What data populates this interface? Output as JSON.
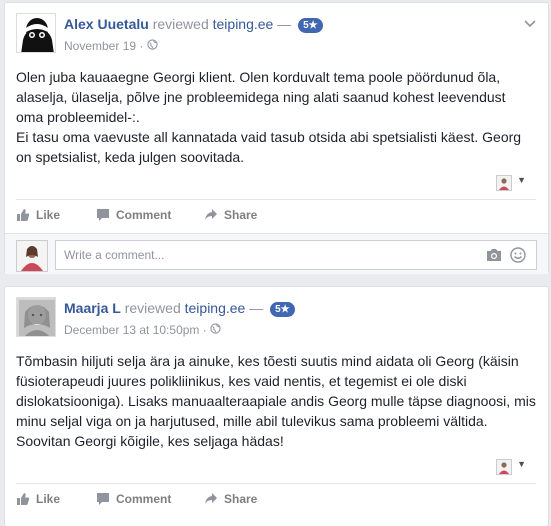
{
  "reviews": [
    {
      "author": "Alex Uuetalu",
      "action": "reviewed",
      "page": "teiping.ee",
      "separator": "—",
      "rating": "5★",
      "date": "November 19",
      "dot": "·",
      "text": [
        "Olen juba kauaaegne Georgi klient. Olen korduvalt tema poole pöördunud õla, alaselja, ülaselja, põlve jne probleemidega ning alati saanud kohest leevendust oma probleemidel-:.",
        "Ei tasu oma vaevuste all kannatada vaid tasub otsida abi spetsialisti käest. Georg on spetsialist, keda julgen soovitada."
      ]
    },
    {
      "author": "Maarja L",
      "action": "reviewed",
      "page": "teiping.ee",
      "separator": "—",
      "rating": "5★",
      "date": "December 13 at 10:50pm",
      "dot": "·",
      "text": [
        "Tõmbasin hiljuti selja ära ja ainuke, kes tõesti suutis mind aidata oli Georg (käisin füsioterapeudi juures polikliinikus, kes vaid nentis, et tegemist ei ole diski dislokatsiooniga). Lisaks manuaalteraapiale andis Georg mulle täpse diagnoosi, mis minu seljal viga on ja harjutused, mille abil tulevikus sama probleemi vältida. Soovitan Georgi kõigile, kes seljaga hädas!"
      ]
    }
  ],
  "actions": {
    "like": "Like",
    "comment": "Comment",
    "share": "Share"
  },
  "comment_box": {
    "placeholder": "Write a comment..."
  },
  "icons": {
    "globe": "globe-icon",
    "chevron": "chevron-down-icon",
    "camera": "camera-icon",
    "smiley": "smiley-icon",
    "like": "thumbs-up-icon",
    "comment": "comment-icon",
    "share": "share-icon"
  },
  "colors": {
    "link": "#365899",
    "badge": "#4267b2",
    "muted": "#90949c",
    "background": "#e9ebee"
  }
}
